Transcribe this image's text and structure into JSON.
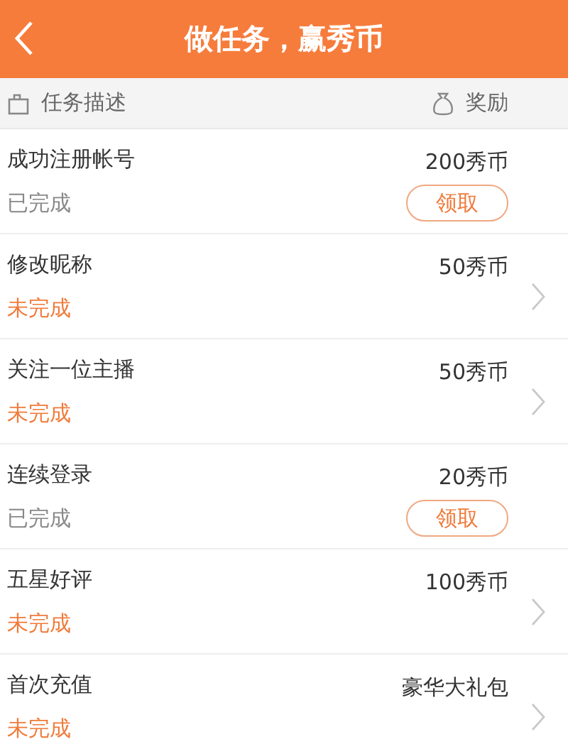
{
  "header": {
    "title": "做任务，赢秀币"
  },
  "columns": {
    "task": "任务描述",
    "reward": "奖励"
  },
  "tasks": [
    {
      "name": "成功注册帐号",
      "reward": "200秀币",
      "status": "已完成",
      "completed": true,
      "button": "领取"
    },
    {
      "name": "修改昵称",
      "reward": "50秀币",
      "status": "未完成",
      "completed": false
    },
    {
      "name": "关注一位主播",
      "reward": "50秀币",
      "status": "未完成",
      "completed": false
    },
    {
      "name": "连续登录",
      "reward": "20秀币",
      "status": "已完成",
      "completed": true,
      "button": "领取"
    },
    {
      "name": "五星好评",
      "reward": "100秀币",
      "status": "未完成",
      "completed": false
    },
    {
      "name": "首次充值",
      "reward": "豪华大礼包",
      "status": "未完成",
      "completed": false
    }
  ]
}
